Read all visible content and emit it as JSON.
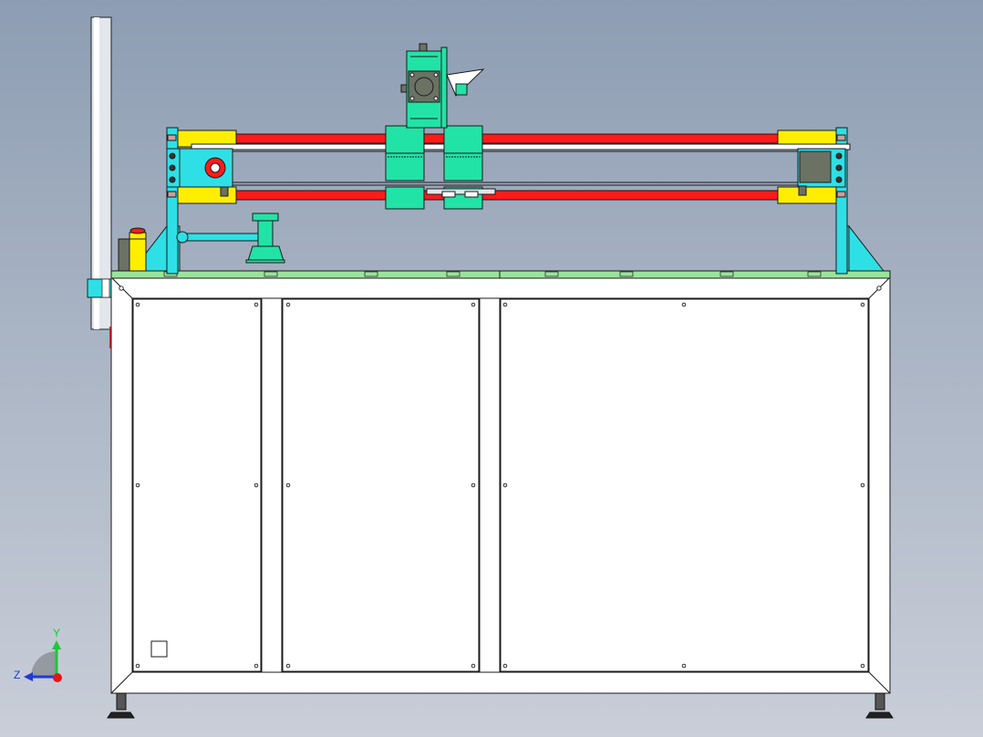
{
  "colors": {
    "background_top": "#8d9db3",
    "background_bottom": "#c9ced8",
    "frame_fill": "#ffffff",
    "frame_line": "#1a1a1a",
    "rod_red": "#ff1a1a",
    "block_yellow": "#ffee00",
    "bracket_cyan": "#2ee0e6",
    "carriage_green": "#22e3a6",
    "base_plate_green": "#9ce39c",
    "motor_gray": "#6b7264"
  },
  "view_triad": {
    "axes": [
      {
        "label": "Y",
        "color": "#22c43a"
      },
      {
        "label": "Z",
        "color": "#1f3bd6"
      }
    ],
    "origin_color": "#e8141a"
  }
}
